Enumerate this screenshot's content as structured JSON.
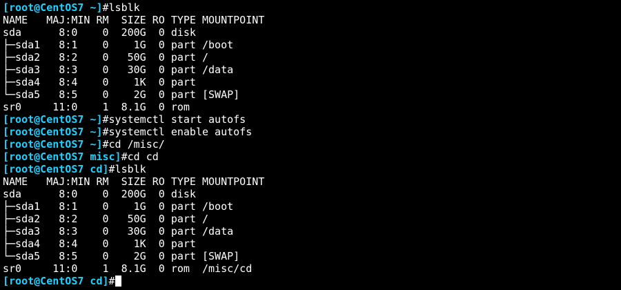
{
  "terminal": {
    "prompt_color": "#1fd1ff",
    "text_color": "#ffffff",
    "background": "#000000",
    "lines": [
      {
        "type": "prompt",
        "prompt": "[root@CentOS7 ~]",
        "cmd": "#lsblk"
      },
      {
        "type": "out",
        "text": "NAME   MAJ:MIN RM  SIZE RO TYPE MOUNTPOINT"
      },
      {
        "type": "out",
        "text": "sda      8:0    0  200G  0 disk"
      },
      {
        "type": "out",
        "text": "├─sda1   8:1    0    1G  0 part /boot"
      },
      {
        "type": "out",
        "text": "├─sda2   8:2    0   50G  0 part /"
      },
      {
        "type": "out",
        "text": "├─sda3   8:3    0   30G  0 part /data"
      },
      {
        "type": "out",
        "text": "├─sda4   8:4    0    1K  0 part"
      },
      {
        "type": "out",
        "text": "└─sda5   8:5    0    2G  0 part [SWAP]"
      },
      {
        "type": "out",
        "text": "sr0     11:0    1  8.1G  0 rom"
      },
      {
        "type": "prompt",
        "prompt": "[root@CentOS7 ~]",
        "cmd": "#systemctl start autofs"
      },
      {
        "type": "prompt",
        "prompt": "[root@CentOS7 ~]",
        "cmd": "#systemctl enable autofs"
      },
      {
        "type": "prompt",
        "prompt": "[root@CentOS7 ~]",
        "cmd": "#cd /misc/"
      },
      {
        "type": "prompt",
        "prompt": "[root@CentOS7 misc]",
        "cmd": "#cd cd"
      },
      {
        "type": "prompt",
        "prompt": "[root@CentOS7 cd]",
        "cmd": "#lsblk"
      },
      {
        "type": "out",
        "text": "NAME   MAJ:MIN RM  SIZE RO TYPE MOUNTPOINT"
      },
      {
        "type": "out",
        "text": "sda      8:0    0  200G  0 disk"
      },
      {
        "type": "out",
        "text": "├─sda1   8:1    0    1G  0 part /boot"
      },
      {
        "type": "out",
        "text": "├─sda2   8:2    0   50G  0 part /"
      },
      {
        "type": "out",
        "text": "├─sda3   8:3    0   30G  0 part /data"
      },
      {
        "type": "out",
        "text": "├─sda4   8:4    0    1K  0 part"
      },
      {
        "type": "out",
        "text": "└─sda5   8:5    0    2G  0 part [SWAP]"
      },
      {
        "type": "out",
        "text": "sr0     11:0    1  8.1G  0 rom  /misc/cd"
      },
      {
        "type": "prompt",
        "prompt": "[root@CentOS7 cd]",
        "cmd": "#",
        "cursor": true
      }
    ]
  }
}
